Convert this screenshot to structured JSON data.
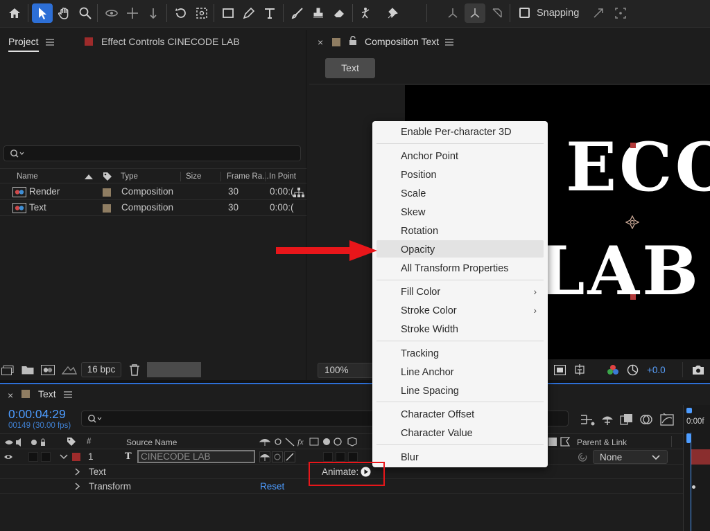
{
  "toolbar": {
    "tools": [
      "home-icon",
      "selection-arrow-icon",
      "hand-icon",
      "zoom-icon",
      "orbit-camera-icon",
      "pan-camera-icon",
      "dolly-camera-icon",
      "rotate-icon",
      "pan-behind-icon",
      "rectangle-icon",
      "pen-icon",
      "type-icon",
      "brush-icon",
      "clone-stamp-icon",
      "eraser-icon",
      "roto-brush-icon",
      "puppet-pin-icon"
    ],
    "snapping_label": "Snapping",
    "accent": "#2d6fd6"
  },
  "project_panel": {
    "tab_project": "Project",
    "tab_effect_controls": "Effect Controls CINECODE LAB",
    "columns": {
      "name": "Name",
      "type": "Type",
      "size": "Size",
      "frame_rate": "Frame Ra...",
      "in_point": "In Point"
    },
    "items": [
      {
        "name": "Render",
        "type": "Composition",
        "frame_rate": "30",
        "in_point": "0:00:("
      },
      {
        "name": "Text",
        "type": "Composition",
        "frame_rate": "30",
        "in_point": "0:00:("
      }
    ],
    "bpc_label": "16 bpc"
  },
  "comp_panel": {
    "tab_label": "Composition Text",
    "chip_label": "Text",
    "viewer_line1": "ECO",
    "viewer_line2": "LAB",
    "zoom_label": "100%",
    "exposure_label": "+0.0"
  },
  "timeline": {
    "tab_label": "Text",
    "timecode": "0:00:04:29",
    "frame_info": "00149 (30.00 fps)",
    "col_hash": "#",
    "col_source_name": "Source Name",
    "col_parent": "Parent & Link",
    "layer_number": "1",
    "layer_name": "CINECODE LAB",
    "parent_value": "None",
    "prop_text": "Text",
    "prop_transform": "Transform",
    "animate_label": "Animate:",
    "reset_label": "Reset",
    "ruler_label": "0:00f",
    "layer_label_color": "#9e2b2b"
  },
  "context_menu": {
    "groups": [
      [
        "Enable Per-character 3D"
      ],
      [
        "Anchor Point",
        "Position",
        "Scale",
        "Skew",
        "Rotation",
        "Opacity",
        "All Transform Properties"
      ],
      [
        "Fill Color",
        "Stroke Color",
        "Stroke Width"
      ],
      [
        "Tracking",
        "Line Anchor",
        "Line Spacing"
      ],
      [
        "Character Offset",
        "Character Value"
      ],
      [
        "Blur"
      ]
    ],
    "highlighted": "Opacity",
    "submenu_items": [
      "Fill Color",
      "Stroke Color"
    ]
  },
  "annotations": {
    "arrow_color": "#e8161a",
    "box_color": "#e8161a"
  }
}
